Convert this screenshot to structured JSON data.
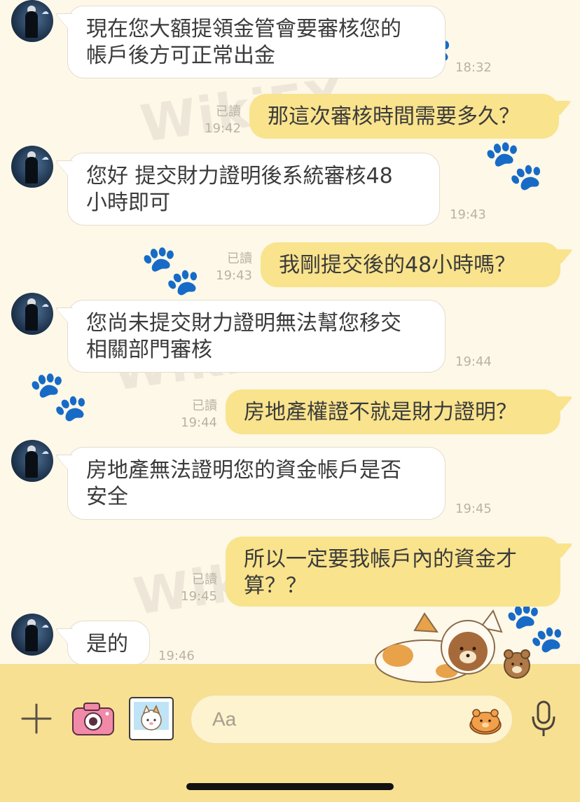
{
  "watermark": {
    "text": "WikiFX"
  },
  "messages": [
    {
      "text": "現在您大額提領金管會要審核您的\n帳戶後方可正常出金",
      "time": "18:32"
    },
    {
      "text": "那這次審核時間需要多久？",
      "time": "19:42",
      "status": "已讀"
    },
    {
      "text": "您好 提交財力證明後系統審核48\n小時即可",
      "time": "19:43"
    },
    {
      "text": "我剛提交後的48小時嗎？",
      "time": "19:43",
      "status": "已讀"
    },
    {
      "text": "您尚未提交財力證明無法幫您移交\n相關部門審核",
      "time": "19:44"
    },
    {
      "text": "房地產權證不就是財力證明？",
      "time": "19:44",
      "status": "已讀"
    },
    {
      "text": "房地產無法證明您的資金帳戶是否\n安全",
      "time": "19:45"
    },
    {
      "text": "所以一定要我帳戶內的資金才\n算？？",
      "time": "19:45",
      "status": "已讀"
    },
    {
      "text": "是的",
      "time": "19:46"
    }
  ],
  "composer": {
    "placeholder": "Aa"
  },
  "colors": {
    "outgoing": "#f9e38c",
    "incoming": "#ffffff",
    "bar": "#f8e093"
  },
  "icons": [
    "plus-icon",
    "camera-icon",
    "photo-sticker-icon",
    "sticker-icon",
    "microphone-icon"
  ]
}
